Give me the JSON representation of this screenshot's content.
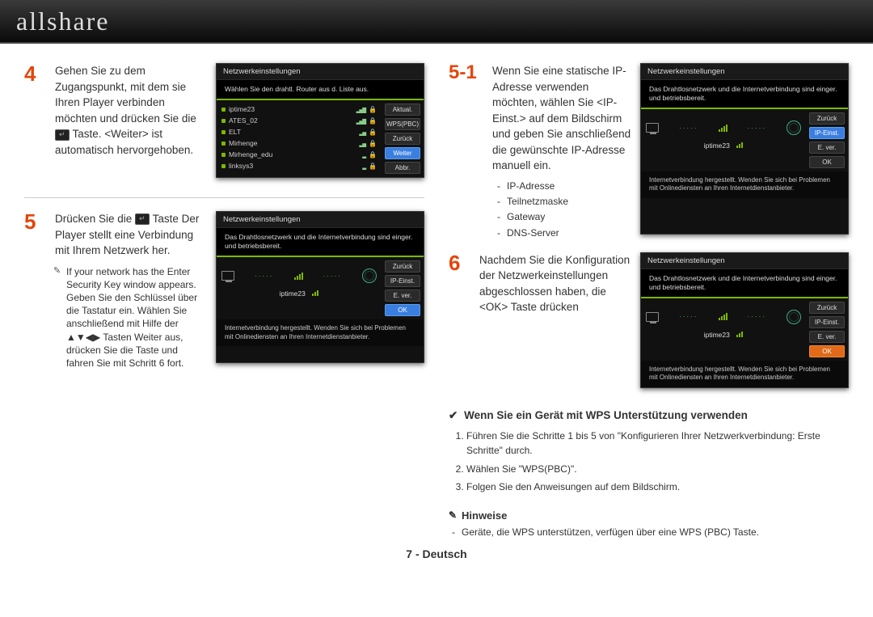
{
  "logo": "allshare",
  "steps": {
    "s4": {
      "num": "4",
      "text_a": "Gehen Sie zu dem Zugangspunkt, mit dem sie Ihren Player verbinden möchten und drücken Sie die ",
      "text_b": " Taste. <Weiter> ist automatisch hervorgehoben."
    },
    "s5": {
      "num": "5",
      "text_a": "Drücken Sie die ",
      "text_b": " Taste Der Player stellt eine Verbindung mit Ihrem Netzwerk her.",
      "note": "If your network has the Enter Security Key window appears. Geben Sie den Schlüssel über die Tastatur ein. Wählen Sie anschließend mit Hilfe der ▲▼◀▶ Tasten Weiter aus, drücken Sie die ",
      "note_b": " Taste und fahren Sie mit Schritt 6 fort."
    },
    "s51": {
      "num": "5-1",
      "text": "Wenn Sie eine statische IP-Adresse verwenden möchten, wählen Sie <IP-Einst.> auf dem Bildschirm und geben Sie anschließend die gewünschte IP-Adresse manuell ein.",
      "bullets": [
        "IP-Adresse",
        "Teilnetzmaske",
        "Gateway",
        "DNS-Server"
      ]
    },
    "s6": {
      "num": "6",
      "text": "Nachdem Sie die Konfiguration der Netzwerkeinstellungen abgeschlossen haben, die <OK> Taste drücken"
    }
  },
  "mini": {
    "title": "Netzwerkeinstellungen",
    "list_prompt": "Wählen Sie den drahtl. Router aus d. Liste aus.",
    "conn_prompt": "Das Drahtlosnetzwerk und die Internetverbindung sind einger. und betriebsbereit.",
    "conn_msg": "Internetverbindung hergestellt. Wenden Sie sich bei Problemen mit Onlinediensten an Ihren Internetdienstanbieter.",
    "ssid": "iptime23",
    "networks": [
      "iptime23",
      "ATES_02",
      "ELT",
      "Mirhenge",
      "Mirhenge_edu",
      "linksys3"
    ],
    "btns_list": [
      "Aktual.",
      "WPS(PBC)",
      "Zurück",
      "Weiter",
      "Abbr."
    ],
    "btns_conn": [
      "Zurück",
      "IP-Einst.",
      "E. ver.",
      "OK"
    ]
  },
  "wps": {
    "head": "Wenn Sie ein Gerät mit WPS Unterstützung verwenden",
    "items": [
      "Führen Sie die Schritte 1 bis 5 von \"Konfigurieren Ihrer Netzwerkverbindung: Erste Schritte\" durch.",
      "Wählen Sie \"WPS(PBC)\".",
      "Folgen Sie den Anweisungen auf dem Bildschirm."
    ]
  },
  "hints": {
    "head": "Hinweise",
    "body": "Geräte, die WPS unterstützen, verfügen über eine WPS (PBC) Taste."
  },
  "footer": "7 - Deutsch"
}
